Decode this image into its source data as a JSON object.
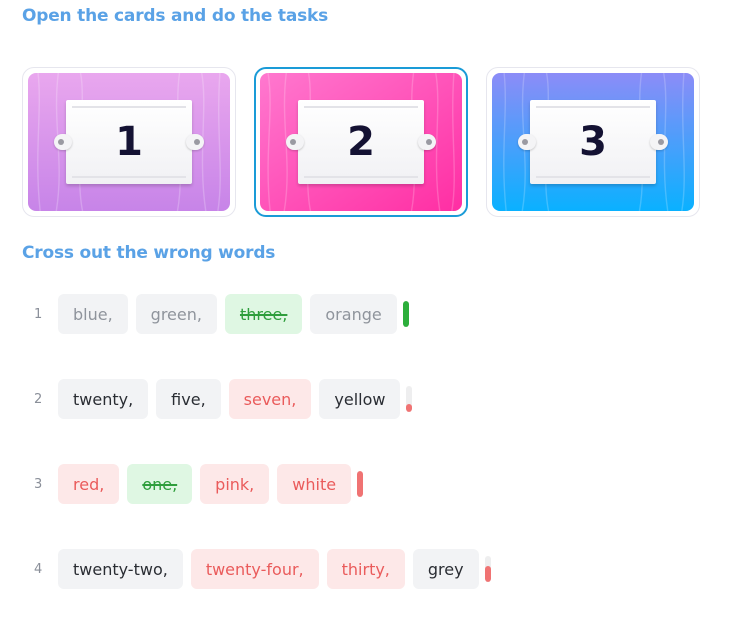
{
  "headings": {
    "open_cards": "Open the cards and do the tasks",
    "cross_out": "Cross out the wrong words"
  },
  "cards": [
    {
      "number": "1",
      "selected": false,
      "colors": [
        "#e9a7ee",
        "#c784e8"
      ]
    },
    {
      "number": "2",
      "selected": true,
      "colors": [
        "#ff78cf",
        "#ff2ea3"
      ]
    },
    {
      "number": "3",
      "selected": false,
      "colors": [
        "#8c8cf7",
        "#0ab1ff"
      ]
    }
  ],
  "rows": [
    {
      "number": "1",
      "words": [
        {
          "text": "blue,",
          "state": "muted"
        },
        {
          "text": "green,",
          "state": "muted"
        },
        {
          "text": "three,",
          "state": "crossed"
        },
        {
          "text": "orange",
          "state": "muted"
        }
      ],
      "progress": {
        "fraction": 1.0,
        "color": "#2cae3b"
      }
    },
    {
      "number": "2",
      "words": [
        {
          "text": "twenty,",
          "state": "plain"
        },
        {
          "text": "five,",
          "state": "plain"
        },
        {
          "text": "seven,",
          "state": "wrong"
        },
        {
          "text": "yellow",
          "state": "plain"
        }
      ],
      "progress": {
        "fraction": 0.3,
        "color": "#f07373"
      }
    },
    {
      "number": "3",
      "words": [
        {
          "text": "red,",
          "state": "wrong"
        },
        {
          "text": "one,",
          "state": "crossed"
        },
        {
          "text": "pink,",
          "state": "wrong"
        },
        {
          "text": "white",
          "state": "wrong"
        }
      ],
      "progress": {
        "fraction": 1.0,
        "color": "#f07373"
      }
    },
    {
      "number": "4",
      "words": [
        {
          "text": "twenty-two,",
          "state": "plain"
        },
        {
          "text": "twenty-four,",
          "state": "wrong"
        },
        {
          "text": "thirty,",
          "state": "wrong"
        },
        {
          "text": "grey",
          "state": "plain"
        }
      ],
      "progress": {
        "fraction": 0.6,
        "color": "#f07373"
      }
    }
  ]
}
